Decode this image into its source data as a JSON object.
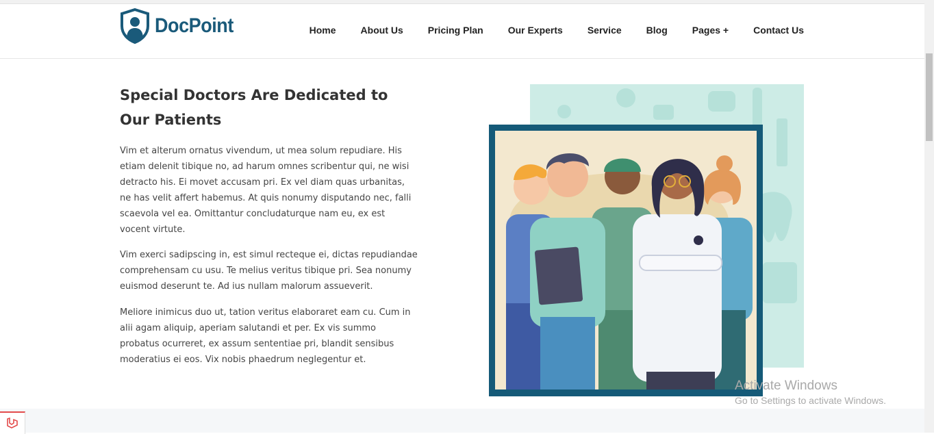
{
  "header": {
    "logo_text": "DocPoint",
    "nav": [
      "Home",
      "About Us",
      "Pricing Plan",
      "Our Experts",
      "Service",
      "Blog",
      "Pages +",
      "Contact Us"
    ]
  },
  "main": {
    "title": "Special Doctors Are Dedicated to Our Patients",
    "paragraphs": [
      "Vim et alterum ornatus vivendum, ut mea solum repudiare. His etiam delenit tibique no, ad harum omnes scribentur qui, ne wisi detracto his. Ei movet accusam pri. Ex vel diam quas urbanitas, ne has velit affert habemus. At quis nonumy disputando nec, falli scaevola vel ea. Omittantur concludaturque nam eu, ex est vocent virtute.",
      "Vim exerci sadipscing in, est simul recteque ei, dictas repudiandae comprehensam cu usu. Te melius veritus tibique pri. Sea nonumy euismod deserunt te. Ad ius nullam malorum assueverit.",
      "Meliore inimicus duo ut, tation veritus elaboraret eam cu. Cum in alii agam aliquip, aperiam salutandi et per. Ex vis summo probatus ocurreret, ex assum sententiae pri, blandit sensibus moderatius ei eos. Vix nobis phaedrum neglegentur et."
    ]
  },
  "watermark": {
    "line1": "Activate Windows",
    "line2": "Go to Settings to activate Windows."
  },
  "colors": {
    "brand": "#1a5a7a",
    "frame": "#155a78",
    "mint": "#bfe6df"
  }
}
